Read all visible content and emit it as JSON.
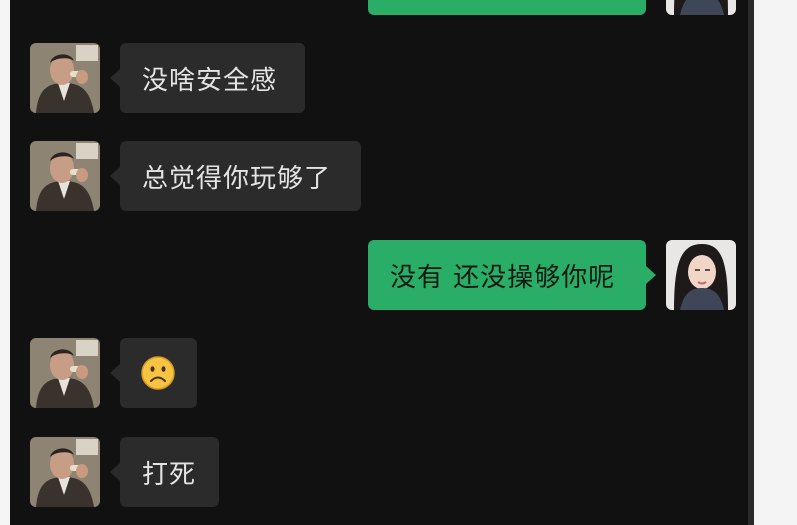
{
  "colors": {
    "chat_background": "#111111",
    "incoming_bubble": "#2b2b2b",
    "outgoing_bubble": "#2aae67",
    "incoming_text": "#e4e4e4",
    "outgoing_text": "#0e1a12"
  },
  "messages": [
    {
      "direction": "outgoing",
      "text": ""
    },
    {
      "direction": "incoming",
      "text": "没啥安全感"
    },
    {
      "direction": "incoming",
      "text": "总觉得你玩够了"
    },
    {
      "direction": "outgoing",
      "text": "没有 还没操够你呢"
    },
    {
      "direction": "incoming",
      "emoji": "frowning-face-emoji"
    },
    {
      "direction": "incoming",
      "text": "打死"
    }
  ]
}
